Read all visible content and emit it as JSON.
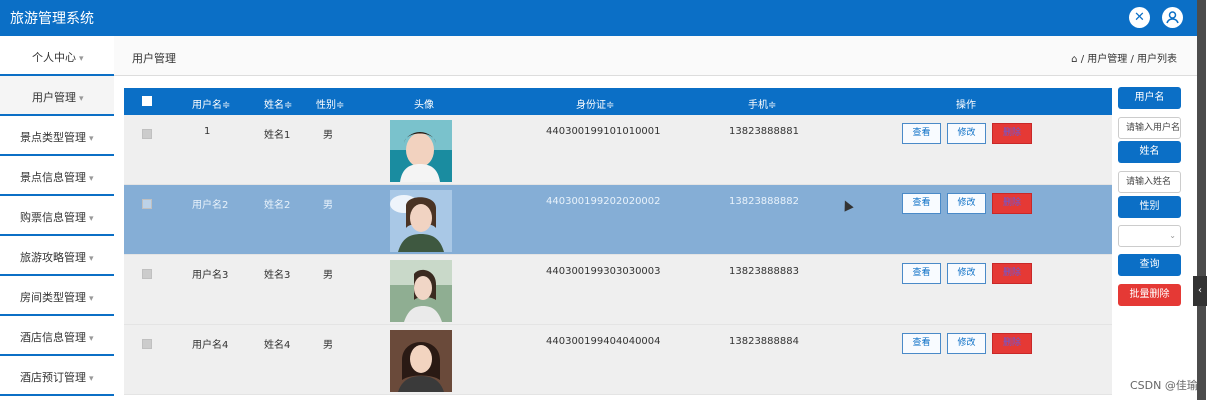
{
  "app": {
    "title": "旅游管理系统"
  },
  "icons": {
    "close": "close-icon",
    "user": "user-icon"
  },
  "sidebar": {
    "personal_center": "个人中心",
    "items": [
      {
        "label": "用户管理",
        "active": true
      },
      {
        "label": "景点类型管理"
      },
      {
        "label": "景点信息管理"
      },
      {
        "label": "购票信息管理"
      },
      {
        "label": "旅游攻略管理"
      },
      {
        "label": "房间类型管理"
      },
      {
        "label": "酒店信息管理"
      },
      {
        "label": "酒店预订管理"
      }
    ]
  },
  "header": {
    "title": "用户管理",
    "breadcrumb": "/ 用户管理 / 用户列表"
  },
  "table": {
    "columns": [
      "用户名",
      "姓名",
      "性别",
      "头像",
      "身份证",
      "手机",
      "操作"
    ],
    "sort_marker": "≑",
    "rows": [
      {
        "username": "1",
        "name": "姓名1",
        "gender": "男",
        "id_card": "440300199101010001",
        "phone": "13823888881",
        "selected": false
      },
      {
        "username": "用户名2",
        "name": "姓名2",
        "gender": "男",
        "id_card": "440300199202020002",
        "phone": "13823888882",
        "selected": true
      },
      {
        "username": "用户名3",
        "name": "姓名3",
        "gender": "男",
        "id_card": "440300199303030003",
        "phone": "13823888883",
        "selected": false
      },
      {
        "username": "用户名4",
        "name": "姓名4",
        "gender": "男",
        "id_card": "440300199404040004",
        "phone": "13823888884",
        "selected": false
      }
    ],
    "actions": {
      "view": "查看",
      "edit": "修改",
      "delete": "删除"
    }
  },
  "search": {
    "username_label": "用户名",
    "username_placeholder": "请输入用户名",
    "name_label": "姓名",
    "name_placeholder": "请输入姓名",
    "gender_label": "性别",
    "gender_value": "",
    "query_button": "查询",
    "batch_delete_button": "批量删除"
  },
  "watermark": "CSDN @佳瑜",
  "colors": {
    "primary": "#0b6fc6",
    "danger": "#e53935",
    "selected_row": "#85aed6"
  }
}
